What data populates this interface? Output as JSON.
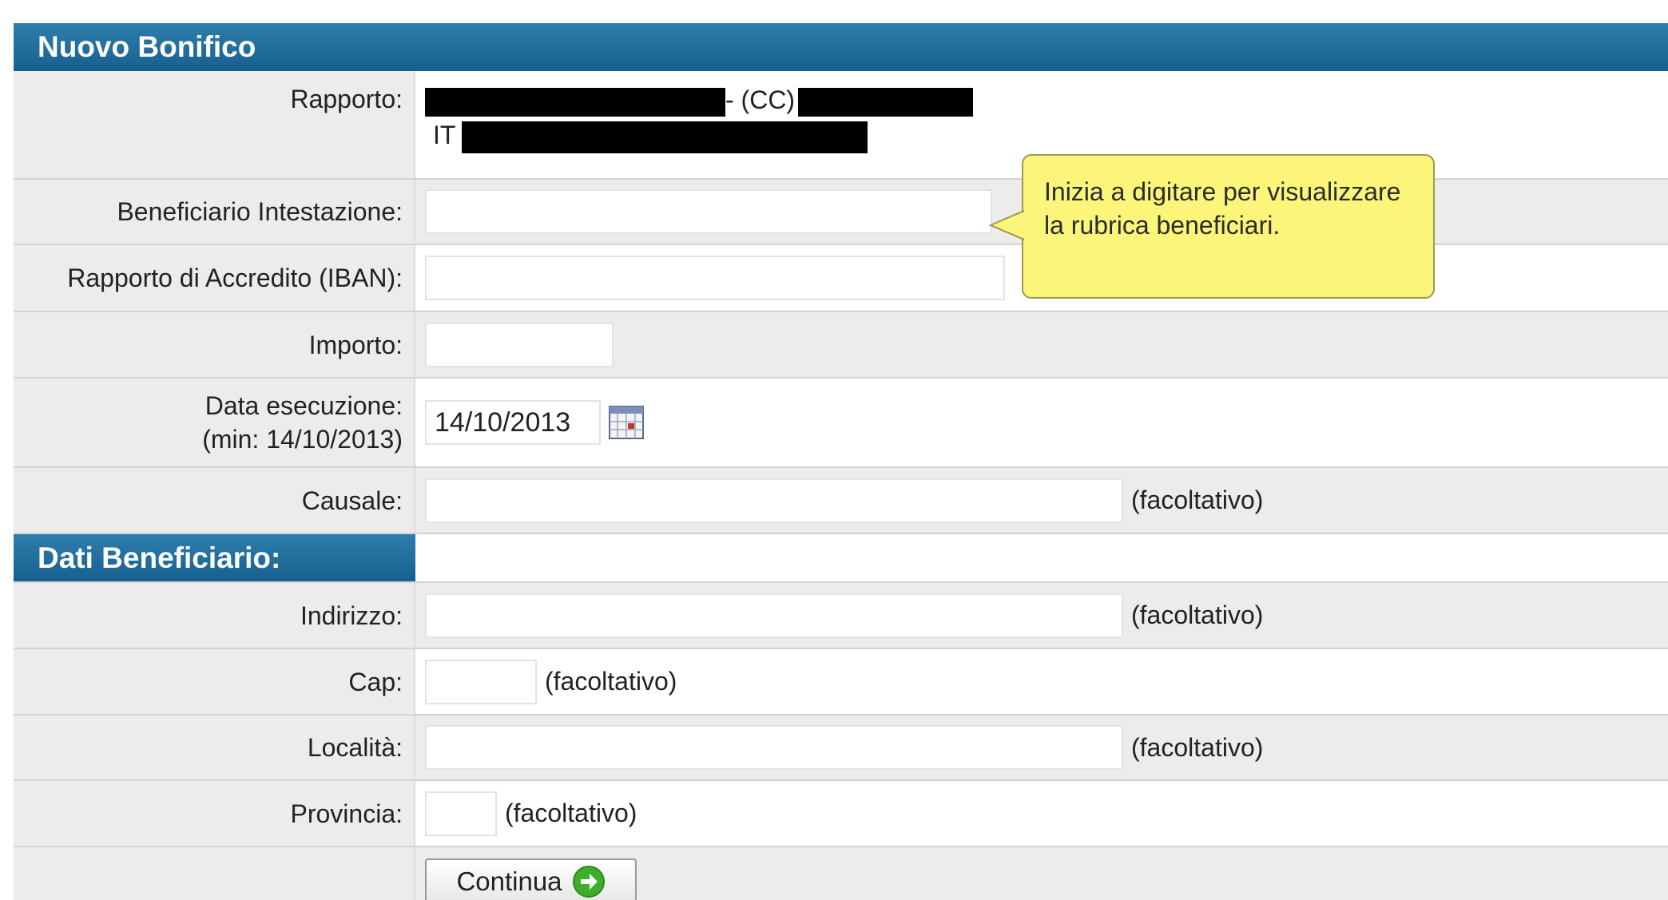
{
  "header": {
    "title": "Nuovo Bonifico"
  },
  "rapporto": {
    "label": "Rapporto:",
    "line1_suffix": "- (CC)",
    "line2_prefix": "IT"
  },
  "beneficiario_intestazione": {
    "label": "Beneficiario Intestazione:",
    "value": ""
  },
  "tooltip": {
    "text": "Inizia a digitare per visualizzare la rubrica beneficiari."
  },
  "iban": {
    "label": "Rapporto di Accredito (IBAN):",
    "value": ""
  },
  "importo": {
    "label": "Importo:",
    "value": ""
  },
  "data_esecuzione": {
    "label": "Data esecuzione:",
    "min_label": "(min: 14/10/2013)",
    "value": "14/10/2013",
    "calendar_icon": "calendar-icon"
  },
  "causale": {
    "label": "Causale:",
    "value": "",
    "optional": "(facoltativo)"
  },
  "dati_beneficiario": {
    "title": "Dati Beneficiario:"
  },
  "indirizzo": {
    "label": "Indirizzo:",
    "value": "",
    "optional": "(facoltativo)"
  },
  "cap": {
    "label": "Cap:",
    "value": "",
    "optional": "(facoltativo)"
  },
  "localita": {
    "label": "Località:",
    "value": "",
    "optional": "(facoltativo)"
  },
  "provincia": {
    "label": "Provincia:",
    "value": "",
    "optional": "(facoltativo)"
  },
  "continua_button": {
    "label": "Continua",
    "icon": "arrow-right-circle-icon"
  },
  "colors": {
    "header_blue": "#16608f",
    "label_bg": "#ececec",
    "tooltip_bg": "#fbf67a",
    "button_icon_green": "#3fae2a"
  }
}
